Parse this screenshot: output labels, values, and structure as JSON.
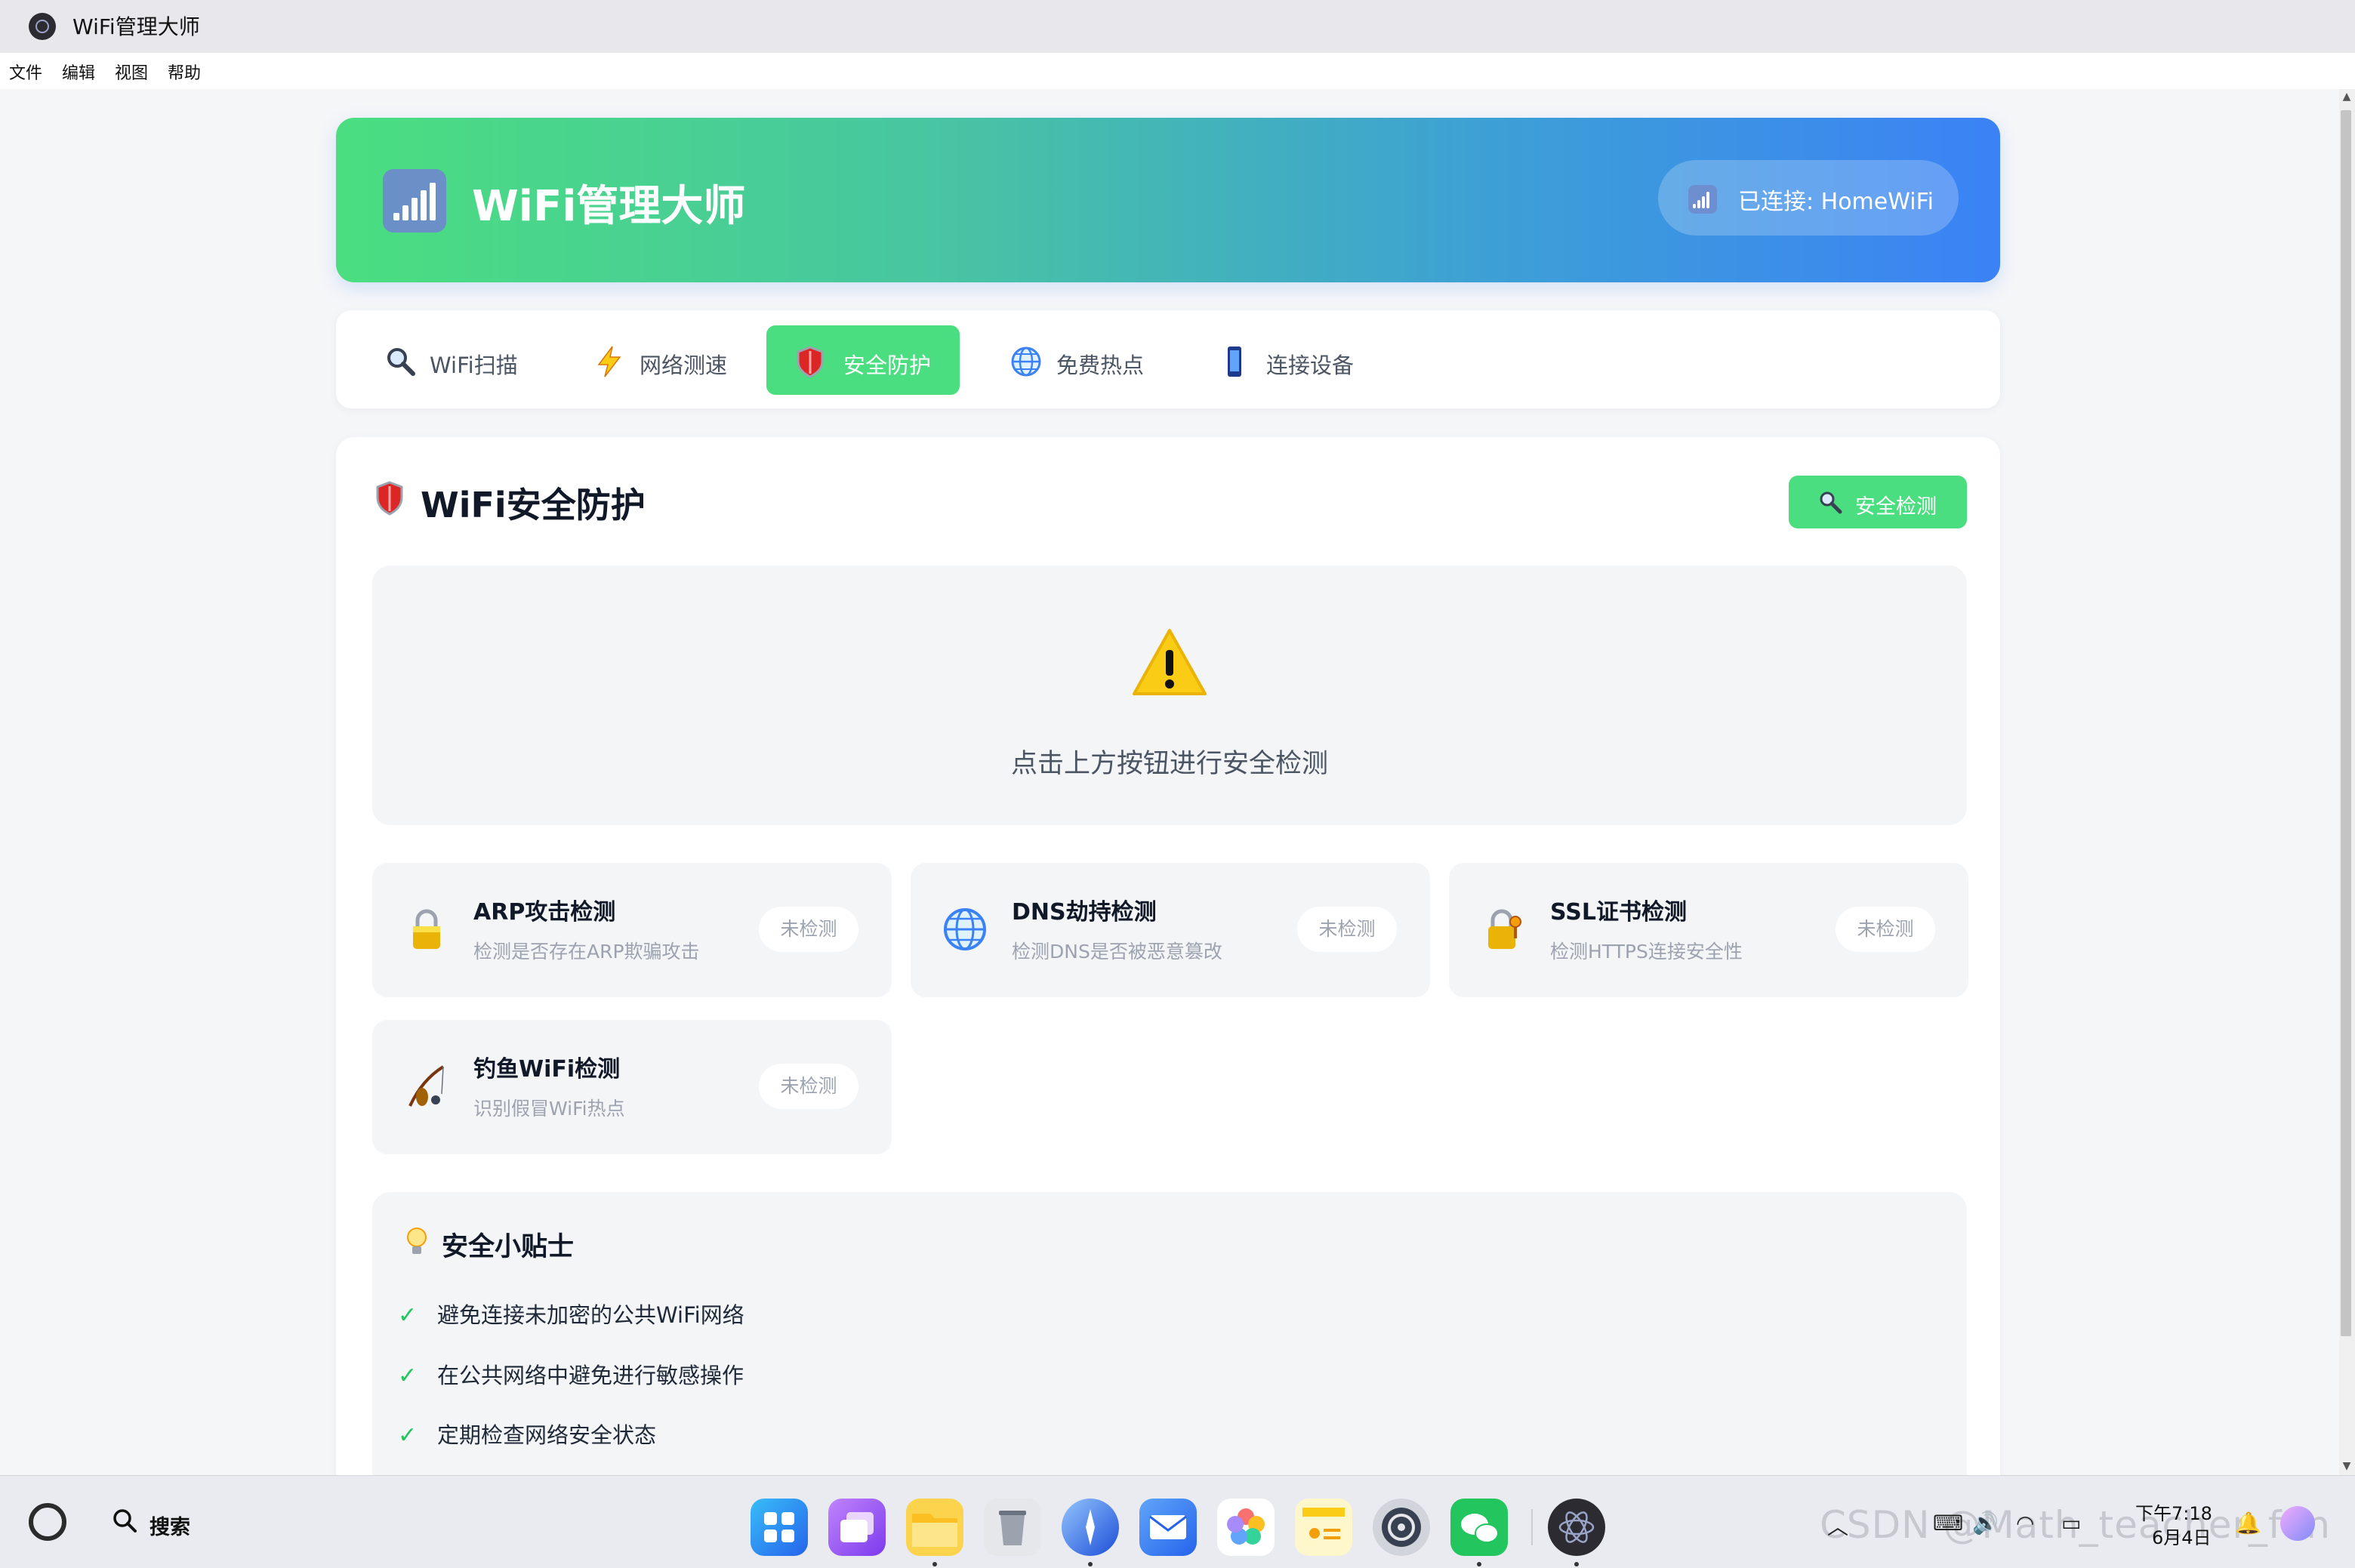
{
  "window": {
    "title": "WiFi管理大师"
  },
  "menu": {
    "items": [
      "文件",
      "编辑",
      "视图",
      "帮助"
    ]
  },
  "header": {
    "app_title": "WiFi管理大师",
    "status": "已连接: HomeWiFi",
    "gradient_start": "#4ade80",
    "gradient_end": "#3b82f6"
  },
  "tabs": [
    {
      "label": "WiFi扫描",
      "icon": "magnifier-icon"
    },
    {
      "label": "网络测速",
      "icon": "lightning-icon"
    },
    {
      "label": "安全防护",
      "icon": "shield-icon",
      "active": true
    },
    {
      "label": "免费热点",
      "icon": "globe-icon"
    },
    {
      "label": "连接设备",
      "icon": "phone-icon"
    }
  ],
  "security": {
    "title": "WiFi安全防护",
    "check_button": "安全检测",
    "notice": "点击上方按钮进行安全检测",
    "items": [
      {
        "title": "ARP攻击检测",
        "desc": "检测是否存在ARP欺骗攻击",
        "status": "未检测",
        "icon": "lock-icon"
      },
      {
        "title": "DNS劫持检测",
        "desc": "检测DNS是否被恶意篡改",
        "status": "未检测",
        "icon": "globe-icon"
      },
      {
        "title": "SSL证书检测",
        "desc": "检测HTTPS连接安全性",
        "status": "未检测",
        "icon": "key-lock-icon"
      },
      {
        "title": "钓鱼WiFi检测",
        "desc": "识别假冒WiFi热点",
        "status": "未检测",
        "icon": "fishing-pole-icon"
      }
    ],
    "tips_title": "安全小贴士",
    "tips": [
      "避免连接未加密的公共WiFi网络",
      "在公共网络中避免进行敏感操作",
      "定期检查网络安全状态"
    ],
    "accent_color": "#4ade80"
  },
  "taskbar": {
    "search_label": "搜索",
    "time": "下午7:18",
    "date": "6月4日",
    "watermark": "CSDN @Math_teacher_fan"
  }
}
